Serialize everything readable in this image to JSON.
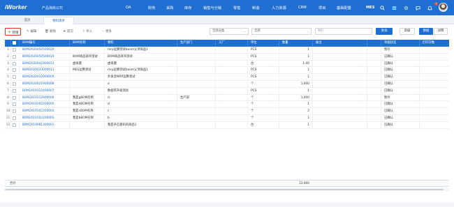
{
  "app": {
    "brand": "iWorker",
    "company": "产品演练公司",
    "nav": [
      "OA",
      "财务",
      "采购",
      "库存",
      "销售与分销",
      "零售",
      "制造",
      "人力资源",
      "CRM",
      "项目",
      "基础配置"
    ],
    "mes_label": "MES",
    "notification_count": "1",
    "icons": [
      "search-icon",
      "menu-icon",
      "settings-icon",
      "message-icon",
      "bell-icon",
      "avatar"
    ]
  },
  "tabs": [
    {
      "label": "首页",
      "active": false
    },
    {
      "label": "物料清单",
      "active": true
    }
  ],
  "toolbar": {
    "add": "新增",
    "edit": "编辑",
    "delete": "删除",
    "submit": "提交",
    "import": "导入",
    "more": "更多",
    "category_select": "全部分类",
    "scope_select": "全部",
    "search_placeholder": "物料",
    "query": "查询",
    "advanced": "高级",
    "view_data": "数据",
    "view_detail": "详情"
  },
  "grid": {
    "columns": [
      "",
      "BOM编号",
      "BOM名称",
      "物料",
      "生产部门",
      "工厂",
      "单位",
      "数量",
      "备注",
      "",
      "单据状态",
      "打印次数"
    ],
    "rows": [
      {
        "no": "1",
        "code": "BOM2020050500020",
        "name": "",
        "material": "mrp运算测试boom父项商品1",
        "dept": "",
        "unit": "PCS",
        "qty": "1",
        "remark": "",
        "status": "暂存",
        "print": ""
      },
      {
        "no": "2",
        "code": "BOM2020050500019",
        "name": "BOM商品排序测试",
        "material": "BOM商品排序测试",
        "dept": "",
        "unit": "PCS",
        "qty": "1",
        "remark": "",
        "status": "已确认",
        "print": ""
      },
      {
        "no": "3",
        "code": "BOM2020042000013",
        "name": "虚拟键",
        "material": "虚拟键",
        "dept": "",
        "unit": "台",
        "qty": "1.00",
        "remark": "",
        "status": "已确认",
        "print": ""
      },
      {
        "no": "4",
        "code": "BOM2020033000011",
        "name": "MES运算测试",
        "material": "mrp运算测试boom父项商品1",
        "dept": "",
        "unit": "PCS",
        "qty": "1",
        "remark": "",
        "status": "已确认",
        "print": ""
      },
      {
        "no": "5",
        "code": "BOM2020032000009",
        "name": "",
        "material": "外发含MRP运算测试",
        "dept": "",
        "unit": "PCS",
        "qty": "1",
        "remark": "",
        "status": "已确认",
        "print": ""
      },
      {
        "no": "6",
        "code": "BOM2020021900008",
        "name": "",
        "material": "a",
        "dept": "",
        "unit": "个",
        "qty": "1,000",
        "remark": "",
        "status": "已确认",
        "print": ""
      },
      {
        "no": "7",
        "code": "BOM2019122400007",
        "name": "",
        "material": "数据库升级测试",
        "dept": "",
        "unit": "PCS",
        "qty": "1",
        "remark": "",
        "status": "已确认",
        "print": ""
      },
      {
        "no": "8",
        "code": "BOM2019112600006",
        "name": "我是gBOM名称",
        "material": "d",
        "dept": "生产部",
        "unit": "个",
        "qty": "1,000",
        "remark": "",
        "status": "暂存",
        "print": ""
      },
      {
        "no": "9",
        "code": "BOM2019102200005",
        "name": "我是dBOM名称",
        "material": "d",
        "dept": "",
        "unit": "个",
        "qty": "1",
        "remark": "",
        "status": "已确认",
        "print": ""
      },
      {
        "no": "10",
        "code": "BOM2019102200004",
        "name": "我是cBOM名称",
        "material": "c",
        "dept": "",
        "unit": "个",
        "qty": "2",
        "remark": "",
        "status": "已确认",
        "print": ""
      },
      {
        "no": "11",
        "code": "BOM2019102200003",
        "name": "我是bBOM名称",
        "material": "b",
        "dept": "",
        "unit": "个",
        "qty": "1",
        "remark": "",
        "status": "已确认",
        "print": ""
      },
      {
        "no": "12",
        "code": "BOM2019081300001",
        "name": "",
        "material": "我是开启基码的商品1",
        "dept": "",
        "unit": "台",
        "qty": "1",
        "remark": "",
        "status": "已确认",
        "print": ""
      }
    ],
    "footer_label": "合计",
    "footer_total": "13.000"
  },
  "colors": {
    "primary": "#1f6fd3",
    "accent_red": "#e4372a"
  }
}
